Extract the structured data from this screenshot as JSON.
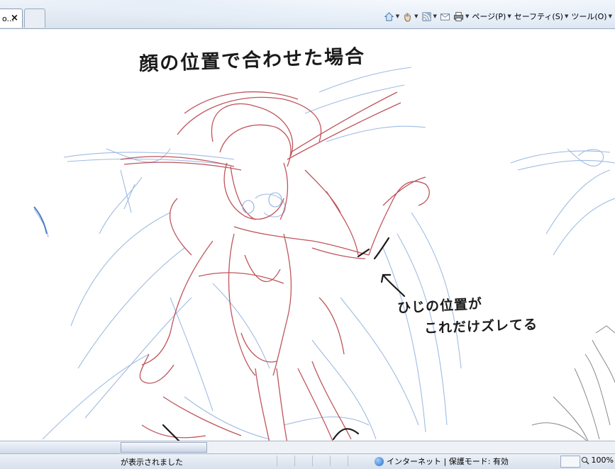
{
  "browser": {
    "tab_label": "o...",
    "tab_close": "×",
    "commands": [
      {
        "label": "ページ(P)",
        "icon": "page-icon"
      },
      {
        "label": "セーフティ(S)",
        "icon": "safety-icon"
      },
      {
        "label": "ツール(O)",
        "icon": "tools-icon"
      }
    ],
    "toolbar_icons": [
      "home-icon",
      "hand-icon",
      "rss-icon",
      "mail-icon",
      "print-icon"
    ]
  },
  "sketch": {
    "title_note": "顔の位置で合わせた場合",
    "note_line1": "ひじの位置が",
    "note_line2": "これだけズレてる"
  },
  "status": {
    "left_text": "が表示されました",
    "zone_text": "インターネット | 保護モード: 有効",
    "zoom_text": "100%"
  },
  "colors": {
    "red_sketch": "#b8434b",
    "blue_sketch": "#8fb0de",
    "gray_sketch": "#6b6b6b"
  }
}
